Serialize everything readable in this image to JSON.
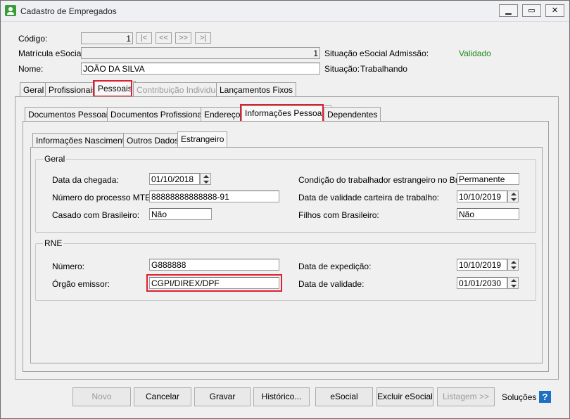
{
  "window": {
    "title": "Cadastro de Empregados"
  },
  "header": {
    "codigo_label": "Código:",
    "codigo_value": "1",
    "nav": [
      "|<",
      "<<",
      ">>",
      ">|"
    ],
    "matricula_label": "Matrícula eSocial:",
    "matricula_value": "1",
    "situacao_admissao_label": "Situação eSocial Admissão:",
    "situacao_admissao_value": "Validado",
    "nome_label": "Nome:",
    "nome_value": "JOÃO DA SILVA",
    "situacao_label": "Situação:",
    "situacao_value": "Trabalhando"
  },
  "tabs_main": [
    "Geral",
    "Profissionais",
    "Pessoais",
    "Contribuição Individual",
    "Lançamentos Fixos"
  ],
  "tabs_pessoais": [
    "Documentos Pessoais",
    "Documentos Profissionais",
    "Endereço",
    "Informações Pessoais",
    "Dependentes"
  ],
  "tabs_info": [
    "Informações Nascimento",
    "Outros Dados",
    "Estrangeiro"
  ],
  "geral": {
    "title": "Geral",
    "data_chegada_label": "Data da chegada:",
    "data_chegada_value": "01/10/2018",
    "processo_label": "Número do processo MTE:",
    "processo_value": "88888888888888-91",
    "casado_label": "Casado com Brasileiro:",
    "casado_value": "Não",
    "condicao_label": "Condição do trabalhador estrangeiro no Brasil:",
    "condicao_value": "Permanente",
    "validade_ctps_label": "Data de validade carteira de trabalho:",
    "validade_ctps_value": "10/10/2019",
    "filhos_label": "Filhos com Brasileiro:",
    "filhos_value": "Não"
  },
  "rne": {
    "title": "RNE",
    "numero_label": "Número:",
    "numero_value": "G888888",
    "orgao_label": "Órgão emissor:",
    "orgao_value": "CGPI/DIREX/DPF",
    "expedicao_label": "Data de expedição:",
    "expedicao_value": "10/10/2019",
    "validade_label": "Data de validade:",
    "validade_value": "01/01/2030"
  },
  "buttons": {
    "novo": "Novo",
    "cancelar": "Cancelar",
    "gravar": "Gravar",
    "historico": "Histórico...",
    "esocial": "eSocial",
    "excluir": "Excluir eSocial",
    "listagem": "Listagem >>",
    "solucoes": "Soluções",
    "help": "?"
  },
  "colors": {
    "highlight": "#e0202e",
    "valid": "#1a8a1a"
  }
}
